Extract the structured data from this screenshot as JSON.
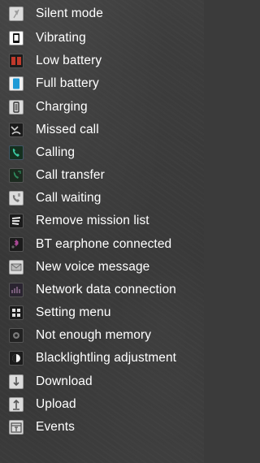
{
  "items": [
    {
      "label": "Silent mode",
      "icon": "silent-mode-icon"
    },
    {
      "label": "Vibrating",
      "icon": "vibrating-icon"
    },
    {
      "label": "Low battery",
      "icon": "low-battery-icon"
    },
    {
      "label": "Full battery",
      "icon": "full-battery-icon"
    },
    {
      "label": "Charging",
      "icon": "charging-icon"
    },
    {
      "label": "Missed call",
      "icon": "missed-call-icon"
    },
    {
      "label": "Calling",
      "icon": "calling-icon"
    },
    {
      "label": "Call transfer",
      "icon": "call-transfer-icon"
    },
    {
      "label": "Call waiting",
      "icon": "call-waiting-icon"
    },
    {
      "label": "Remove mission list",
      "icon": "remove-mission-list-icon"
    },
    {
      "label": "BT earphone connected",
      "icon": "bt-earphone-icon"
    },
    {
      "label": "New voice message",
      "icon": "voice-message-icon"
    },
    {
      "label": "Network data connection",
      "icon": "network-data-icon"
    },
    {
      "label": "Setting menu",
      "icon": "setting-menu-icon"
    },
    {
      "label": "Not enough memory",
      "icon": "memory-icon"
    },
    {
      "label": "Blacklightling adjustment",
      "icon": "backlight-icon"
    },
    {
      "label": "Download",
      "icon": "download-icon"
    },
    {
      "label": "Upload",
      "icon": "upload-icon"
    },
    {
      "label": "Events",
      "icon": "events-icon"
    }
  ]
}
